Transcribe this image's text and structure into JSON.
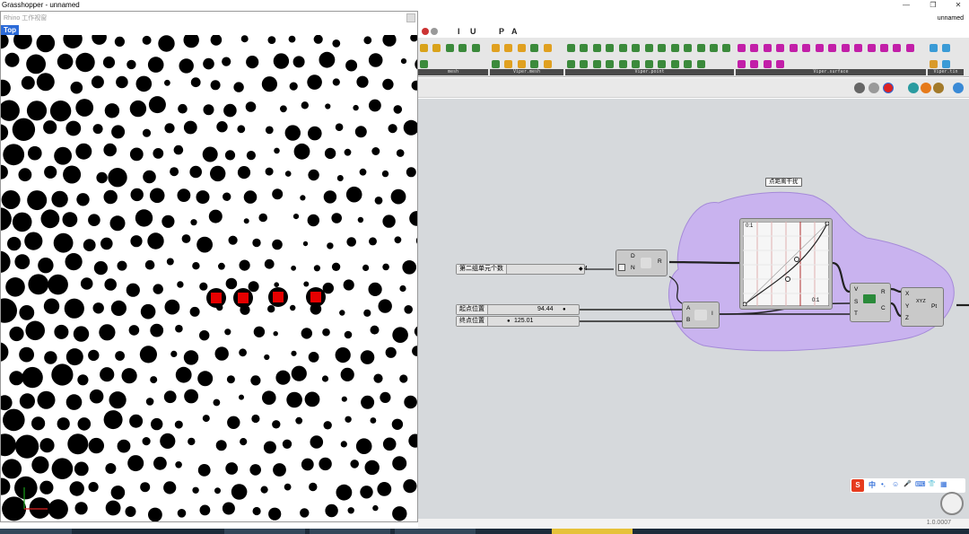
{
  "window": {
    "title": "Grasshopper - unnamed",
    "doc_name": "unnamed",
    "min_glyph": "—",
    "max_glyph": "❐",
    "close_glyph": "✕"
  },
  "menu": {
    "items": [
      "I",
      "U",
      "P",
      "A"
    ]
  },
  "toolbar": {
    "groups": [
      {
        "label": "mesh"
      },
      {
        "label": "Viper.mesh"
      },
      {
        "label": "Viper.point"
      },
      {
        "label": "Viper.surface"
      },
      {
        "label": "Viper.tin"
      }
    ]
  },
  "viewport": {
    "header": "Rhino 工作视窗",
    "name": "Top"
  },
  "canvas": {
    "group_label": "点距离干扰",
    "sliders": {
      "count": {
        "label": "第二组单元个数",
        "value": "4"
      },
      "start": {
        "label": "起点位置",
        "value": "94.44"
      },
      "end": {
        "label": "终点位置",
        "value": "125.01"
      }
    },
    "range_node": {
      "in_d": "D",
      "in_n": "N",
      "out_r": "R"
    },
    "graph_node": {
      "corner_tl": "0:1",
      "corner_br": "0:1"
    },
    "interp_node": {
      "in_a": "A",
      "in_b": "B",
      "out_i": "I"
    },
    "remap_node": {
      "in_v": "V",
      "in_s": "S",
      "in_t": "T",
      "out_r": "R",
      "out_c": "C"
    },
    "pt_node": {
      "in_x": "X",
      "in_y": "Y",
      "in_z": "Z",
      "out_pt": "Pt",
      "icon_text": "XYZ"
    }
  },
  "ime_bar": {
    "items": [
      "S",
      "中",
      "•,",
      "☺",
      "🎤",
      "⌨",
      "👕",
      "▦"
    ]
  },
  "status": {
    "version": "1.0.0007"
  },
  "colors": {
    "accent_blue": "#2b6ad8",
    "group_purple": "#c9b3ef",
    "highlight_red": "#e60000",
    "canvas_bg": "#d6d9dc"
  }
}
